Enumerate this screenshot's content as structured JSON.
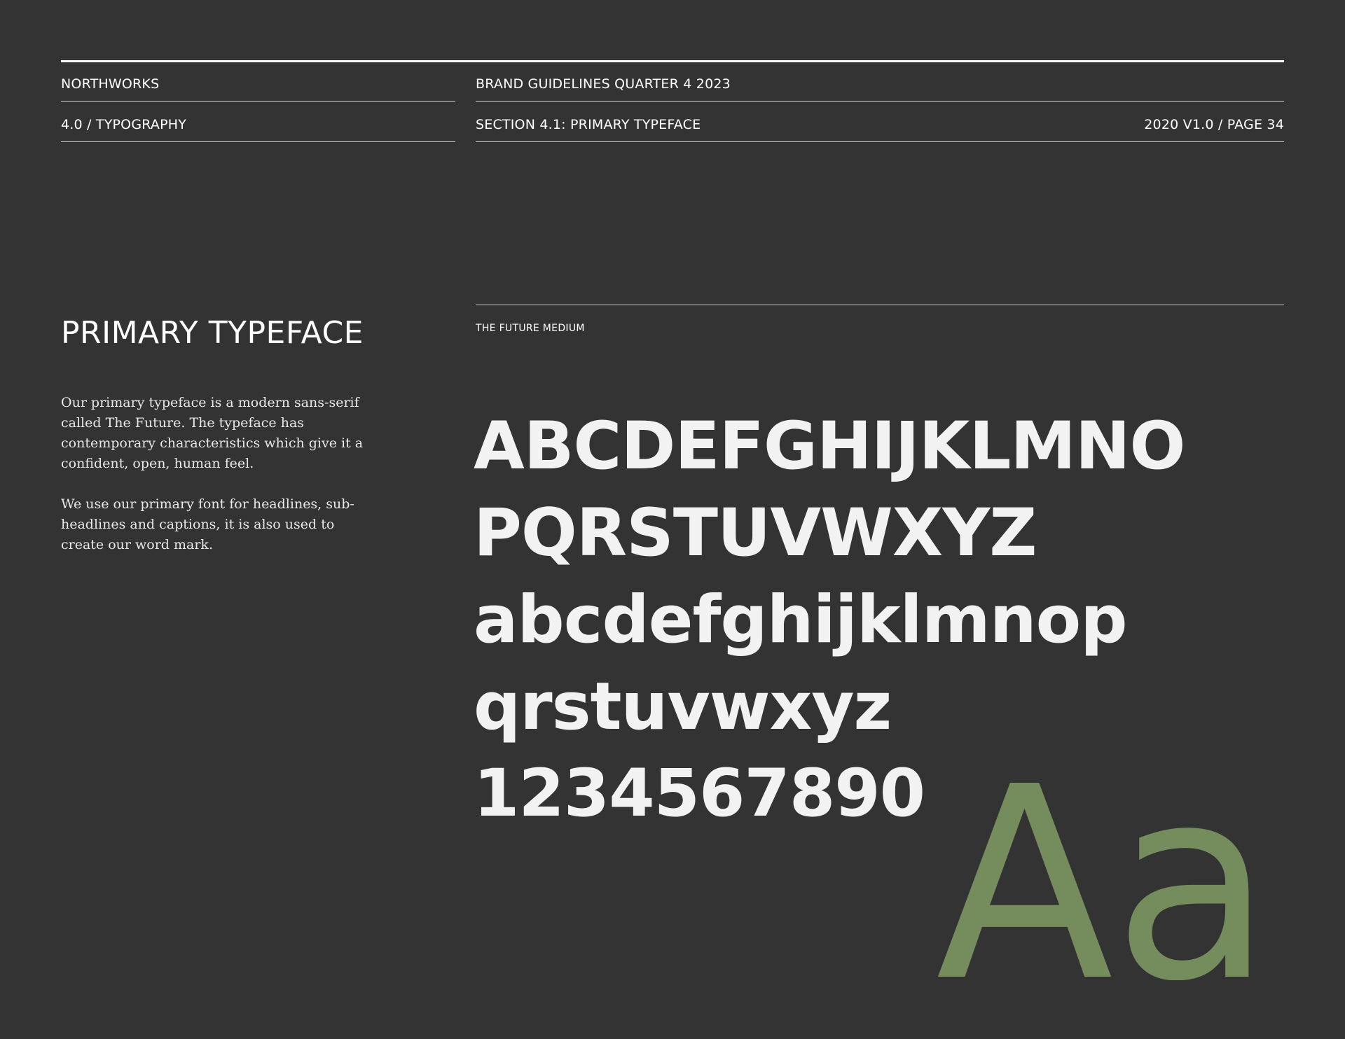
{
  "header": {
    "brand": "NORTHWORKS",
    "document_title": "BRAND GUIDELINES QUARTER 4 2023",
    "chapter": "4.0 / TYPOGRAPHY",
    "section": "SECTION 4.1: PRIMARY TYPEFACE",
    "page_info": "2020 V1.0 / PAGE 34"
  },
  "main": {
    "title": "PRIMARY TYPEFACE",
    "paragraph_1": "Our primary typeface is a modern sans-serif called The Future. The typeface has contemporary characteristics which give it a confident, open, human feel.",
    "paragraph_2": "We use our primary font for headlines, sub-headlines and captions, it is also used to create our word mark."
  },
  "specimen": {
    "typeface_name": "THE FUTURE MEDIUM",
    "uppercase_line_1": "ABCDEFGHIJKLMNO",
    "uppercase_line_2": "PQRSTUVWXYZ",
    "lowercase_line_1": "abcdefghijklmnop",
    "lowercase_line_2": "qrstuvwxyz",
    "numerals": "1234567890",
    "glyph_sample": "Aa"
  },
  "colors": {
    "background": "#333333",
    "text": "#ffffff",
    "accent_green": "#758c5c"
  }
}
